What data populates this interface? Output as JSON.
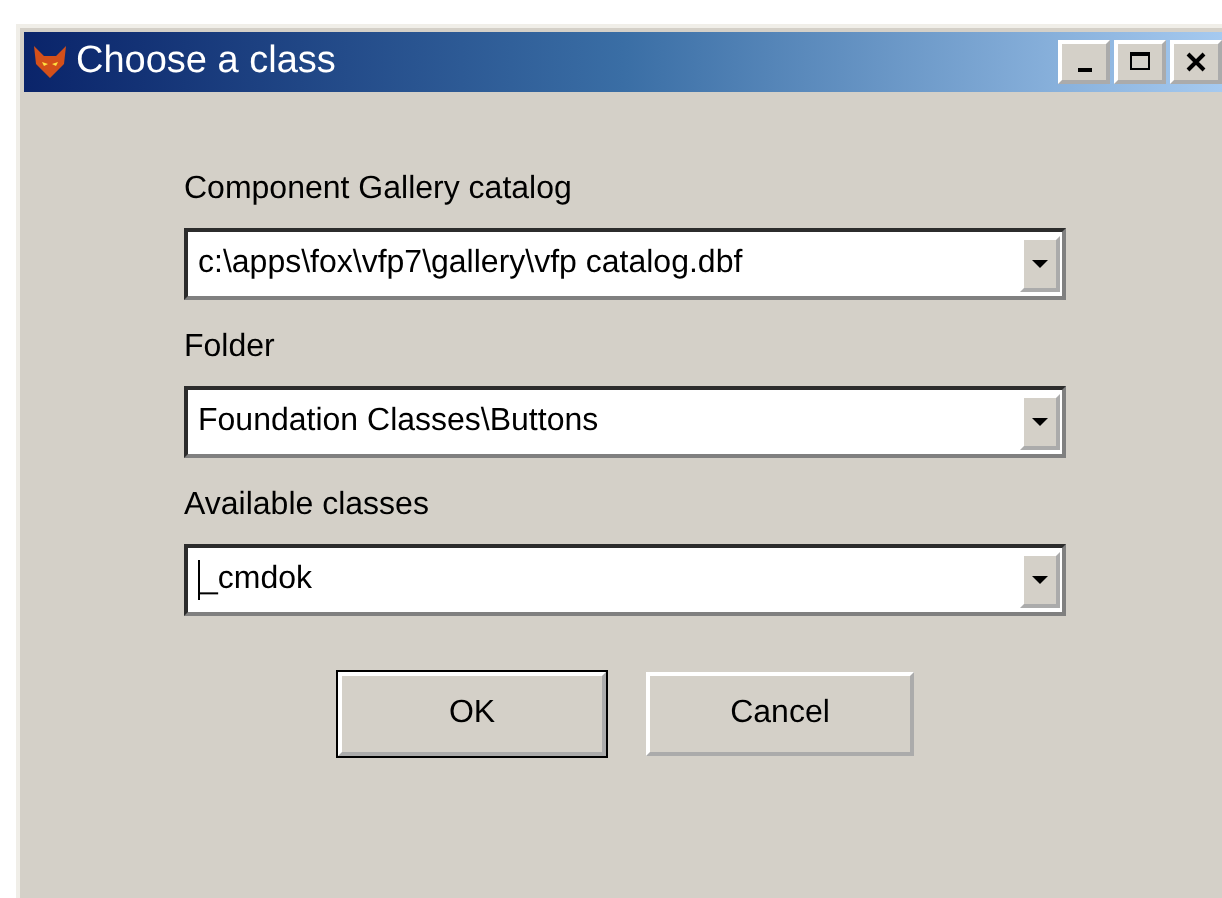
{
  "window": {
    "title": "Choose a class"
  },
  "fields": [
    {
      "label": "Component Gallery catalog",
      "value": "c:\\apps\\fox\\vfp7\\gallery\\vfp catalog.dbf",
      "focused": false
    },
    {
      "label": "Folder",
      "value": "Foundation Classes\\Buttons",
      "focused": false
    },
    {
      "label": "Available classes",
      "value": "_cmdok",
      "focused": true
    }
  ],
  "buttons": [
    {
      "label": "OK",
      "default": true
    },
    {
      "label": "Cancel",
      "default": false
    }
  ]
}
